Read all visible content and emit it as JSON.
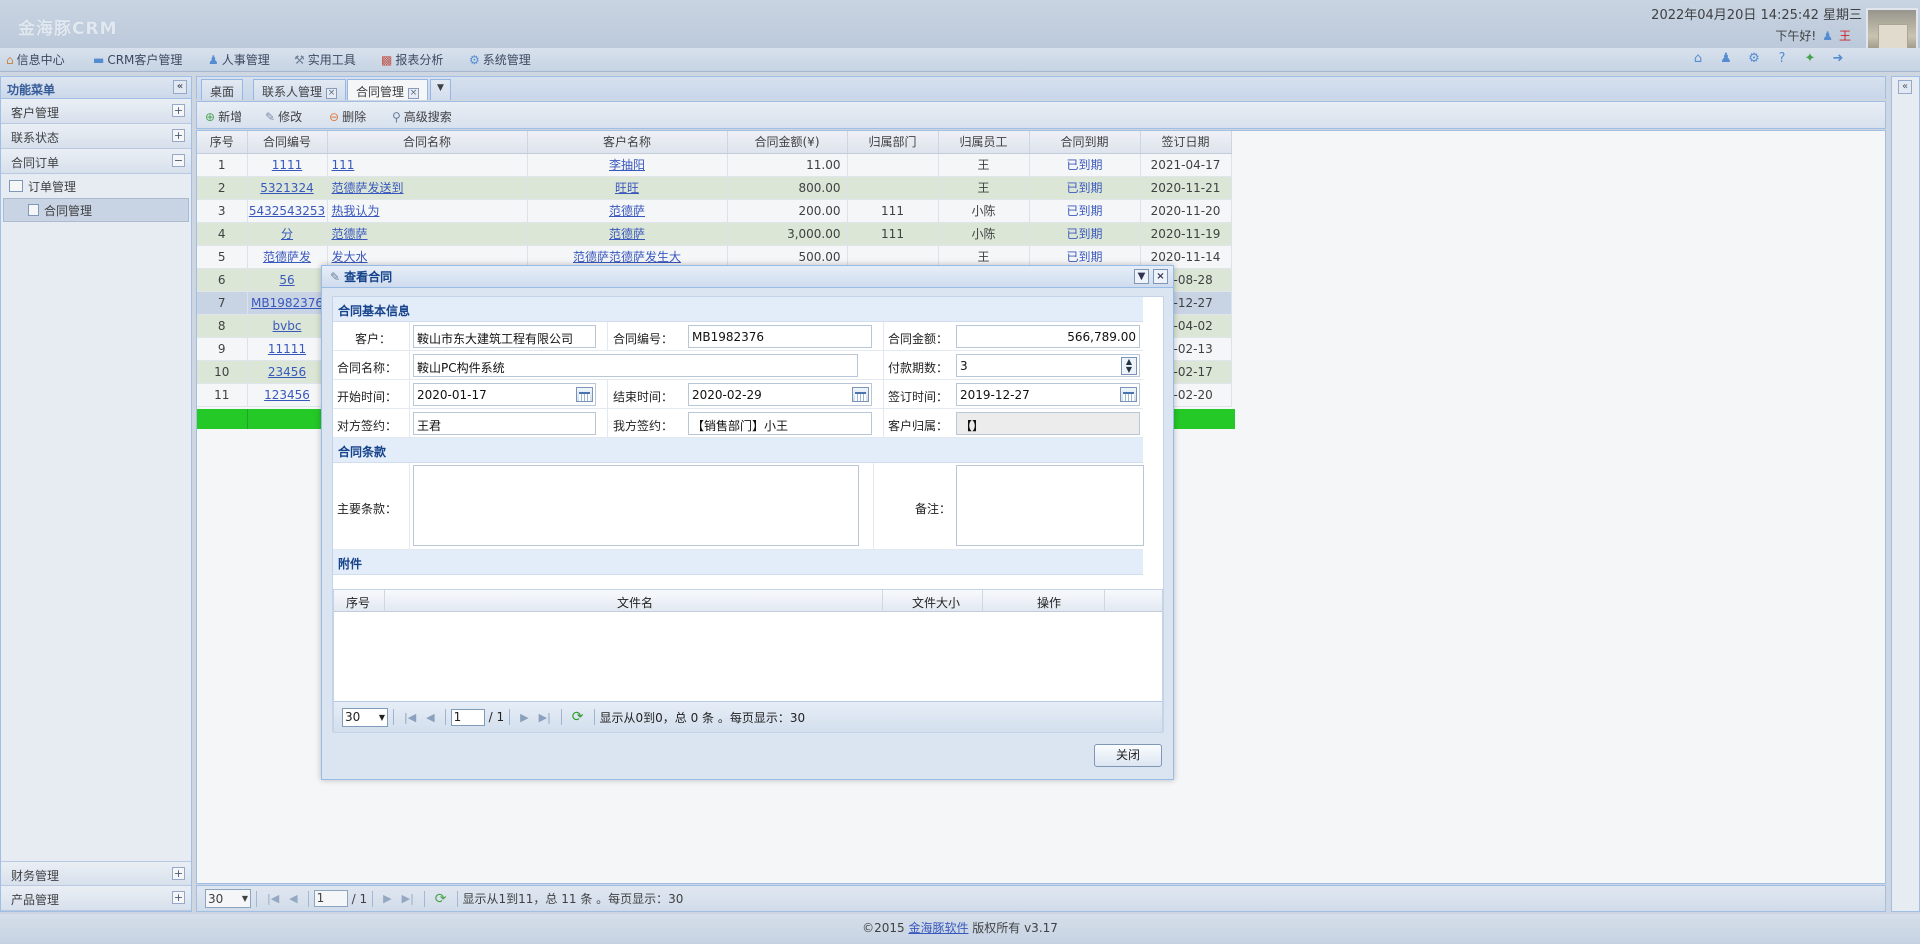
{
  "app": {
    "brand": "金海豚CRM",
    "datetime": "2022年04月20日 14:25:42 星期三",
    "greeting": "下午好!",
    "user": "王"
  },
  "menu": [
    {
      "label": "信息中心",
      "icon": "home-icon"
    },
    {
      "label": "CRM客户管理",
      "icon": "crm-icon"
    },
    {
      "label": "人事管理",
      "icon": "user-icon"
    },
    {
      "label": "实用工具",
      "icon": "tools-icon"
    },
    {
      "label": "报表分析",
      "icon": "chart-icon"
    },
    {
      "label": "系统管理",
      "icon": "gear-icon"
    }
  ],
  "sidebar": {
    "title": "功能菜单",
    "groups": [
      "客户管理",
      "联系状态",
      "合同订单"
    ],
    "subitems": [
      "订单管理",
      "合同管理"
    ],
    "bottom_groups": [
      "财务管理",
      "产品管理"
    ]
  },
  "tabs": [
    "桌面",
    "联系人管理",
    "合同管理"
  ],
  "toolbar": {
    "add": "新增",
    "edit": "修改",
    "delete": "删除",
    "search": "高级搜索"
  },
  "grid": {
    "columns": [
      "序号",
      "合同编号",
      "合同名称",
      "客户名称",
      "合同金额(¥)",
      "归属部门",
      "归属员工",
      "合同到期",
      "签订日期"
    ],
    "rows": [
      [
        "1",
        "1111",
        "111",
        "李抽阳",
        "11.00",
        "",
        "王",
        "已到期",
        "2021-04-17"
      ],
      [
        "2",
        "5321324",
        "范德萨发送到",
        "旺旺",
        "800.00",
        "",
        "王",
        "已到期",
        "2020-11-21"
      ],
      [
        "3",
        "5432543253",
        "热我认为",
        "范德萨",
        "200.00",
        "111",
        "小陈",
        "已到期",
        "2020-11-20"
      ],
      [
        "4",
        "分",
        "范德萨",
        "范德萨",
        "3,000.00",
        "111",
        "小陈",
        "已到期",
        "2020-11-19"
      ],
      [
        "5",
        "范德萨发",
        "发大水",
        "范德萨范德萨发生大",
        "500.00",
        "",
        "王",
        "已到期",
        "2020-11-14"
      ],
      [
        "6",
        "56",
        "",
        "",
        "",
        "",
        "",
        "",
        "20-08-28"
      ],
      [
        "7",
        "MB1982376",
        "",
        "",
        "",
        "",
        "",
        "",
        "19-12-27"
      ],
      [
        "8",
        "bvbc",
        "",
        "",
        "",
        "",
        "",
        "",
        "19-04-02"
      ],
      [
        "9",
        "11111",
        "",
        "",
        "",
        "",
        "",
        "",
        "19-02-13"
      ],
      [
        "10",
        "23456",
        "",
        "",
        "",
        "",
        "",
        "",
        "19-02-17"
      ],
      [
        "11",
        "123456",
        "",
        "",
        "",
        "",
        "",
        "",
        "19-02-20"
      ]
    ]
  },
  "pager": {
    "page_size": "30",
    "page": "1",
    "total_pages": "/ 1",
    "info": "显示从1到11，总 11 条 。每页显示：30"
  },
  "footer": {
    "prefix": "©2015 ",
    "link": "金海豚软件",
    "suffix": " 版权所有 v3.17"
  },
  "dialog": {
    "title": "查看合同",
    "sections": {
      "basic": "合同基本信息",
      "terms": "合同条款",
      "attachments": "附件"
    },
    "fields": {
      "customer": {
        "label": "客户：",
        "value": "鞍山市东大建筑工程有限公司"
      },
      "contract_no": {
        "label": "合同编号：",
        "value": "MB1982376"
      },
      "amount": {
        "label": "合同金额：",
        "value": "566,789.00"
      },
      "contract_name": {
        "label": "合同名称：",
        "value": "鞍山PC构件系统"
      },
      "installments": {
        "label": "付款期数：",
        "value": "3"
      },
      "start_date": {
        "label": "开始时间：",
        "value": "2020-01-17"
      },
      "end_date": {
        "label": "结束时间：",
        "value": "2020-02-29"
      },
      "sign_date": {
        "label": "签订时间：",
        "value": "2019-12-27"
      },
      "their_signer": {
        "label": "对方签约：",
        "value": "王君"
      },
      "our_signer": {
        "label": "我方签约：",
        "value": "【销售部门】小王"
      },
      "owner": {
        "label": "客户归属：",
        "value": "【】"
      },
      "main_terms": {
        "label": "主要条款：",
        "value": ""
      },
      "remarks": {
        "label": "备注：",
        "value": ""
      }
    },
    "att_columns": [
      "序号",
      "文件名",
      "文件大小",
      "操作"
    ],
    "att_pager": {
      "page_size": "30",
      "page": "1",
      "total_pages": "/ 1",
      "info": "显示从0到0，总 0 条 。每页显示：30"
    },
    "close": "关闭"
  }
}
